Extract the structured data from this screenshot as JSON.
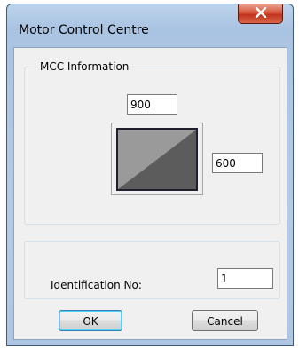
{
  "window": {
    "title": "Motor Control Centre"
  },
  "mcc_group": {
    "title": "MCC Information",
    "width_value": "900",
    "height_value": "600"
  },
  "id_group": {
    "label": "Identification No:",
    "value": "1"
  },
  "buttons": {
    "ok": "OK",
    "cancel": "Cancel"
  },
  "colors": {
    "preview_fill_dark": "#5c5c5c",
    "preview_fill_light": "#9a9a9a",
    "close_button": "#c2321c"
  },
  "icons": {
    "close": "close-x-icon",
    "preview": "mcc-shape-preview"
  }
}
